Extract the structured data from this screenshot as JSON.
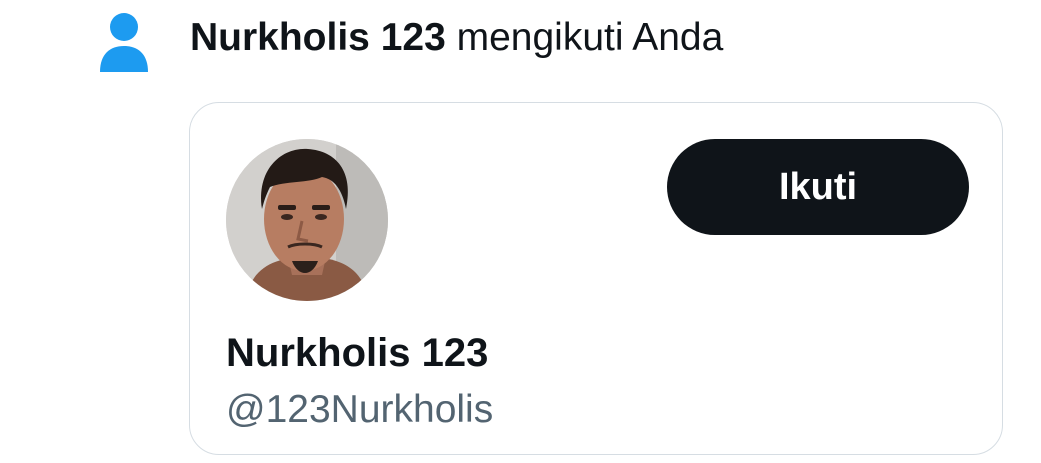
{
  "notification": {
    "icon": "person-icon",
    "icon_color": "#1d9bf0",
    "user_name": "Nurkholis 123",
    "action_text": "mengikuti Anda"
  },
  "user_card": {
    "avatar": "user-avatar",
    "follow_button_label": "Ikuti",
    "display_name": "Nurkholis 123",
    "handle": "@123Nurkholis"
  },
  "colors": {
    "primary_text": "#0f1419",
    "secondary_text": "#536471",
    "button_background": "#0f1419",
    "button_text": "#ffffff",
    "card_border": "#d6dde3"
  }
}
